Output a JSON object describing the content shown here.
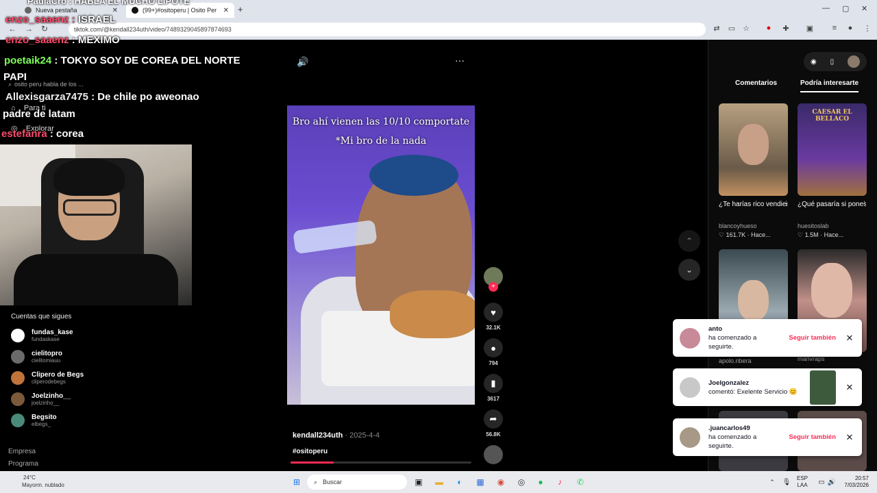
{
  "browser": {
    "tabs": [
      {
        "label": "Nueva pestaña"
      },
      {
        "label": "(99+)#ositoperu | Osito Per"
      }
    ],
    "new_tab": "+",
    "url": "tiktok.com/@kendall234uth/video/7489329045897874693",
    "window_controls": [
      "—",
      "▢",
      "✕"
    ]
  },
  "chat_overlay": [
    {
      "user": "enzo_saaenz",
      "sep": " : ",
      "msg": "ISRAEL"
    },
    {
      "user": "enzo_saaenz",
      "sep": " : ",
      "msg": "MEXIMO"
    },
    {
      "user": "poetaik24",
      "sep": " : ",
      "msg": "TOKYO SOY DE COREA DEL NORTE"
    },
    {
      "user": "",
      "sep": "",
      "msg": "PAPI"
    },
    {
      "user": "Allexisgarza7475",
      "sep": " : ",
      "msg": "De chile po aweonao"
    },
    {
      "user": "",
      "sep": "",
      "msg": "padre de latam"
    },
    {
      "user": "estefanra",
      "sep": " : ",
      "msg": "corea"
    }
  ],
  "top_banner_text": "PaulaCro : HABLA EL MUCHO LIPOTE",
  "left_nav": {
    "search_placeholder": "osito peru habla de los ...",
    "items": [
      "Para ti",
      "Explorar"
    ]
  },
  "following": {
    "heading": "Cuentas que sigues",
    "accounts": [
      {
        "name": "fundas_kase",
        "handle": "fundaskase",
        "color": "#ffffff"
      },
      {
        "name": "cielitopro",
        "handle": "cielitomiauu",
        "color": "#6b6b6b"
      },
      {
        "name": "Clipero de Begs",
        "handle": "cliperodebegs",
        "color": "#c0733a"
      },
      {
        "name": "Joelzinho__",
        "handle": "joelzinho__",
        "color": "#7a5a3a"
      },
      {
        "name": "Begsito",
        "handle": "elbegs_",
        "color": "#4a8a7a"
      }
    ],
    "footer_links": [
      "Empresa",
      "Programa"
    ]
  },
  "video": {
    "caption_line1": "Bro ahí vienen las 10/10 comportate",
    "caption_line2": "*Mi bro de la nada",
    "author": "kendall234uth",
    "date": " · 2025-4-4",
    "hashtag": "#ositoperu",
    "progress": 0.24,
    "volume_icon": "🔊",
    "more_icon": "···"
  },
  "actions": {
    "likes": "32.1K",
    "comments": "794",
    "saves": "3617",
    "shares": "56.8K"
  },
  "right_panel": {
    "tabs": [
      "Comentarios",
      "Podría interesarte"
    ],
    "recommendations": [
      {
        "title": "¿Te harías rico vendiendo cevic...",
        "channel": "blancoyhueso",
        "stats": "♡ 161.7K · Hace..."
      },
      {
        "title": "¿Qué pasaría si pones Esclava...",
        "channel": "huesitoslab",
        "stats": "♡ 1.5M · Hace..."
      },
      {
        "title": "",
        "channel": "apolo.ribera",
        "stats": ""
      },
      {
        "title": "",
        "channel": "marivraps",
        "stats": ""
      }
    ],
    "thumb2_text": "CAESAR EL BELLACO"
  },
  "notifications": [
    {
      "name": "anto",
      "text": "ha comenzado a seguirte.",
      "action": "Seguir también"
    },
    {
      "name": "Joelgonzalez",
      "text": "comentó: Exelente Servicio 😊",
      "action": ""
    },
    {
      "name": ".juancarlos49",
      "text": "ha comenzado a seguirte.",
      "action": "Seguir también"
    }
  ],
  "taskbar": {
    "weather_temp": "24°C",
    "weather_desc": "Mayorm. nublado",
    "search_label": "Buscar",
    "lang1": "ESP",
    "lang2": "LAA",
    "time": "20:57",
    "date": "7/03/2026"
  }
}
